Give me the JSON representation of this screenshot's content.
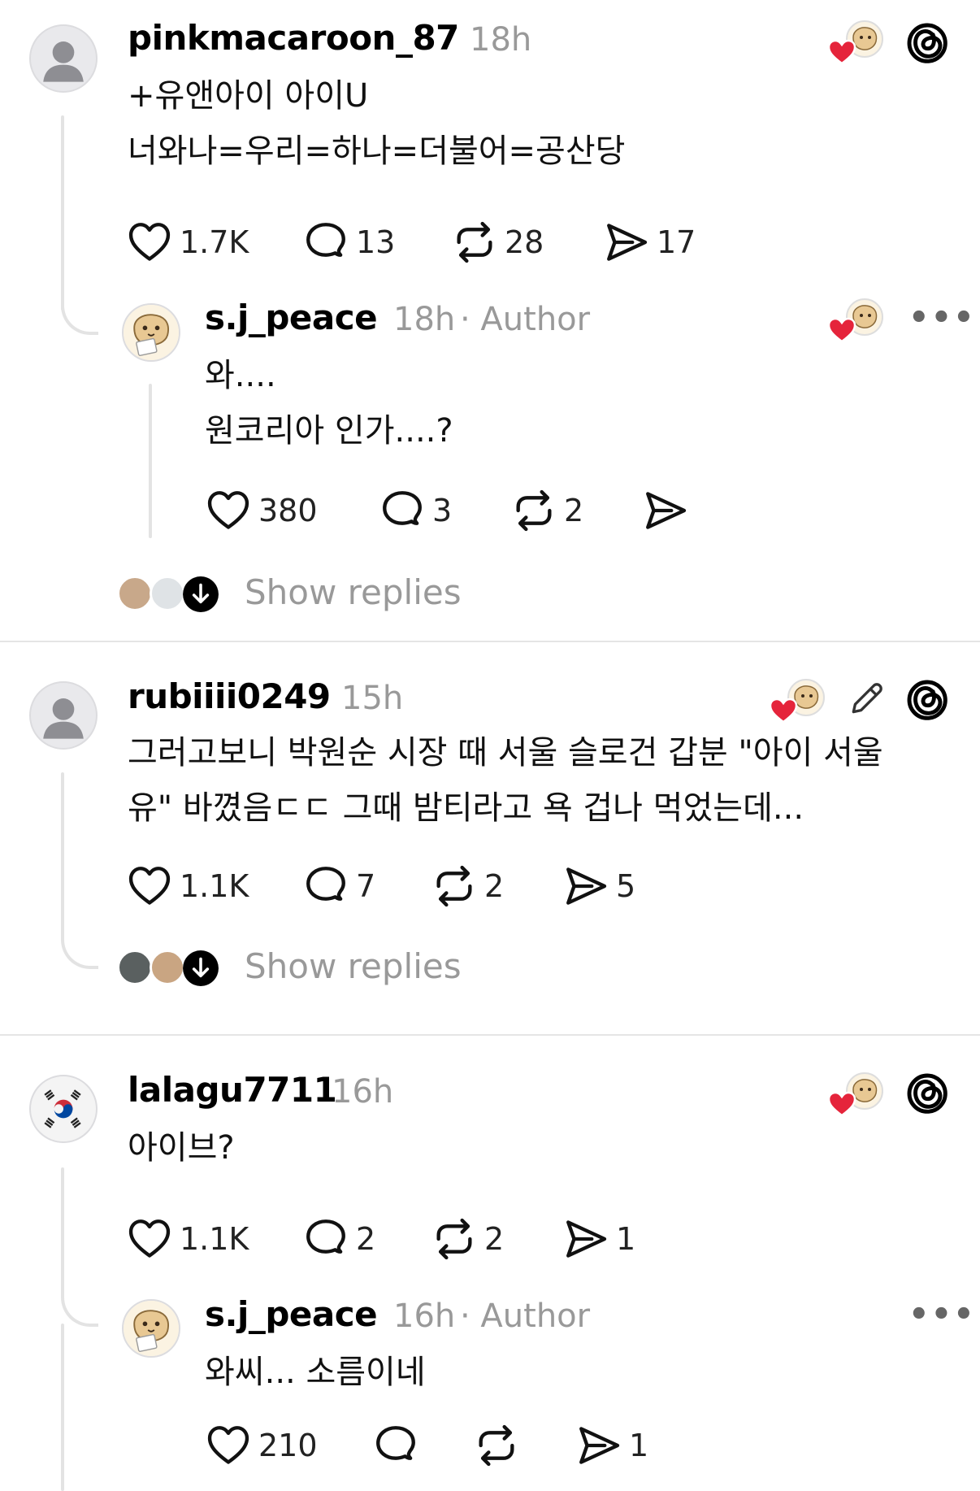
{
  "colors": {
    "heart": "#e5243b",
    "line": "#e3e3e3",
    "muted": "#999999"
  },
  "posts": [
    {
      "username": "pinkmacaroon_87",
      "time": "18h",
      "lines": [
        "+유앤아이 아이U",
        "너와나=우리=하나=더불어=공산당"
      ],
      "likes": "1.7K",
      "replies": "13",
      "reposts": "28",
      "shares": "17",
      "reply": {
        "username": "s.j_peace",
        "time": "18h",
        "author": "· Author",
        "lines": [
          "와....",
          "원코리아 인가....?"
        ],
        "likes": "380",
        "replies": "3",
        "reposts": "2",
        "shares": ""
      },
      "show_replies": "Show replies"
    },
    {
      "username": "rubiiii0249",
      "time": "15h",
      "lines": [
        "그러고보니 박원순 시장 때 서울 슬로건 갑분 \"아이 서울",
        "유\" 바꼈음ㄷㄷ 그때 밤티라고 욕 겁나 먹었는데..."
      ],
      "likes": "1.1K",
      "replies": "7",
      "reposts": "2",
      "shares": "5",
      "show_replies": "Show replies"
    },
    {
      "username": "lalagu7711",
      "time": "16h",
      "lines": [
        "아이브?"
      ],
      "likes": "1.1K",
      "replies": "2",
      "reposts": "2",
      "shares": "1",
      "reply": {
        "username": "s.j_peace",
        "time": "16h",
        "author": "· Author",
        "lines": [
          "와씨... 소름이네"
        ],
        "likes": "210",
        "replies": "",
        "reposts": "",
        "shares": "1"
      }
    }
  ],
  "icons": {
    "like": "heart-outline-icon",
    "reply": "speech-bubble-icon",
    "repost": "repost-arrows-icon",
    "share": "paper-plane-icon",
    "threads": "threads-logo-icon",
    "edit": "pencil-icon",
    "more": "ellipsis-icon"
  }
}
